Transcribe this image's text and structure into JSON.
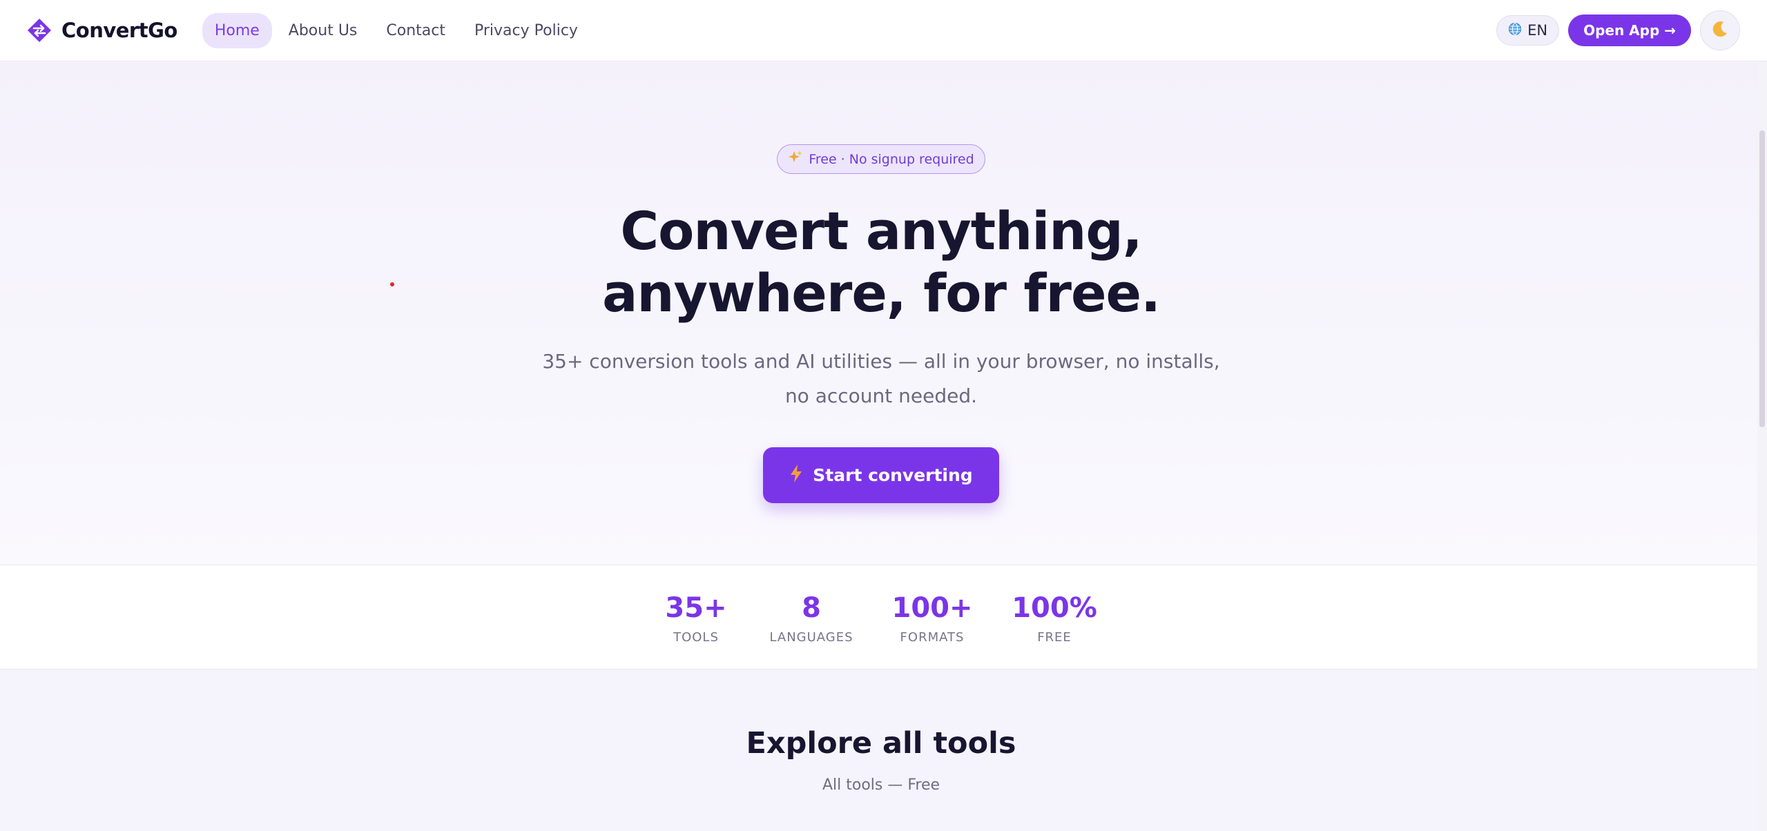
{
  "brand": {
    "name": "ConvertGo",
    "accent": "#7b35e8"
  },
  "nav": {
    "links": [
      {
        "label": "Home",
        "active": true
      },
      {
        "label": "About Us",
        "active": false
      },
      {
        "label": "Contact",
        "active": false
      },
      {
        "label": "Privacy Policy",
        "active": false
      }
    ],
    "language": {
      "icon": "globe-icon",
      "label": "EN"
    },
    "open_app_label": "Open App →",
    "theme_icon": "moon-icon"
  },
  "hero": {
    "badge_icon": "sparkles-icon",
    "badge": "Free · No signup required",
    "title_line1": "Convert anything,",
    "title_line2": "anywhere, for free.",
    "subtitle_line1": "35+ conversion tools and AI utilities — all in your browser, no installs,",
    "subtitle_line2": "no account needed.",
    "cta_icon": "lightning-icon",
    "cta_label": "Start converting"
  },
  "stats": [
    {
      "value": "35+",
      "label": "TOOLS"
    },
    {
      "value": "8",
      "label": "LANGUAGES"
    },
    {
      "value": "100+",
      "label": "FORMATS"
    },
    {
      "value": "100%",
      "label": "FREE"
    }
  ],
  "explore": {
    "title": "Explore all tools",
    "subtitle": "All tools — Free"
  }
}
